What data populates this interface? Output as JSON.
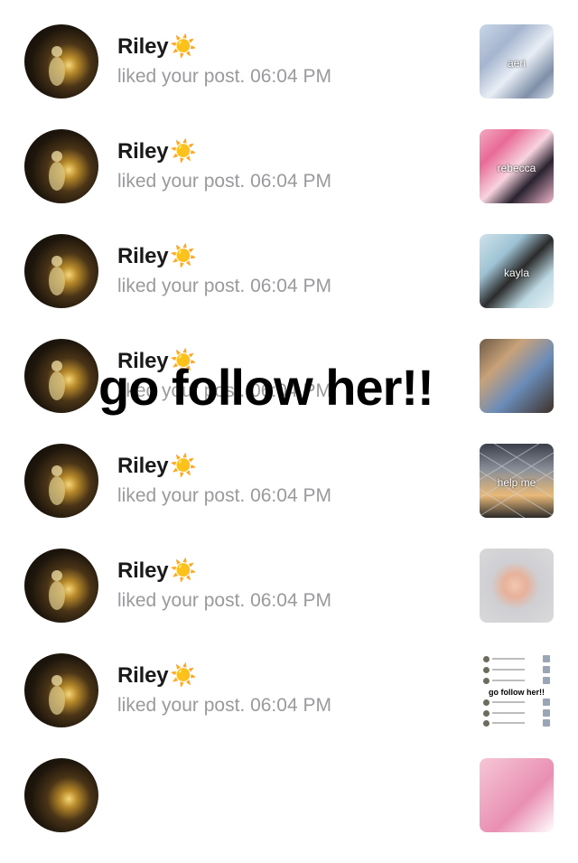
{
  "overlay": {
    "text": "go follow her!!"
  },
  "notifications": [
    {
      "name": "Riley",
      "emoji": "☀️",
      "action": "liked your post. 06:04 PM",
      "thumb_caption": "aeri"
    },
    {
      "name": "Riley",
      "emoji": "☀️",
      "action": "liked your post. 06:04 PM",
      "thumb_caption": "rebecca"
    },
    {
      "name": "Riley",
      "emoji": "☀️",
      "action": "liked your post. 06:04 PM",
      "thumb_caption": "kayla"
    },
    {
      "name": "Riley",
      "emoji": "☀️",
      "action": "liked your post. 06:04 PM",
      "thumb_caption": ""
    },
    {
      "name": "Riley",
      "emoji": "☀️",
      "action": "liked your post. 06:04 PM",
      "thumb_caption": "help me"
    },
    {
      "name": "Riley",
      "emoji": "☀️",
      "action": "liked your post. 06:04 PM",
      "thumb_caption": ""
    },
    {
      "name": "Riley",
      "emoji": "☀️",
      "action": "liked your post. 06:04 PM",
      "thumb_caption": "go follow her!!"
    }
  ],
  "theme": {
    "name_color": "#1a1a1a",
    "meta_color": "#9a9a9e",
    "overlay_color": "#000000"
  }
}
